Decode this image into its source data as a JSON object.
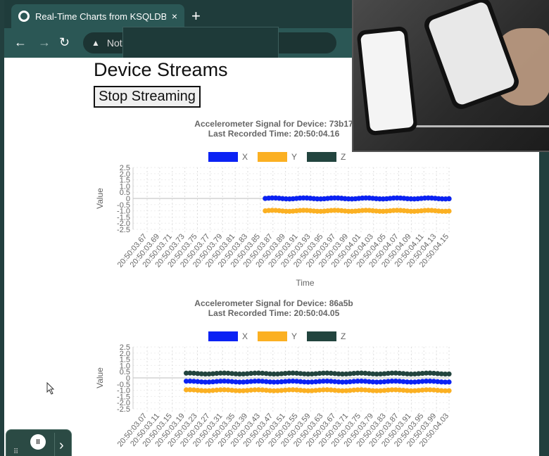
{
  "browser": {
    "tab_title": "Real-Time Charts from KSQLDB",
    "tab_close": "×",
    "new_tab": "+",
    "nav_back": "←",
    "nav_forward": "→",
    "reload": "↻",
    "omnibox_security": "Not"
  },
  "page": {
    "heading": "Device Streams",
    "stop_button": "Stop Streaming"
  },
  "colors": {
    "x": "#0b22f4",
    "y": "#fbb022",
    "z": "#22443e",
    "axis_text": "#666666",
    "grid": "#d8d8d8"
  },
  "charts": [
    {
      "title_line1": "Accelerometer Signal for Device: 73b17",
      "title_line2": "Last Recorded Time:  20:50:04.16",
      "legend": [
        "X",
        "Y",
        "Z"
      ],
      "xlabel": "Time",
      "ylabel": "Value"
    },
    {
      "title_line1": "Accelerometer Signal for Device: 86a5b",
      "title_line2": "Last Recorded Time:  20:50:04.05",
      "legend": [
        "X",
        "Y",
        "Z"
      ],
      "xlabel": "",
      "ylabel": "Value"
    }
  ],
  "chart_data": [
    {
      "type": "line",
      "title": "Accelerometer Signal for Device: 73b17",
      "subtitle": "Last Recorded Time:  20:50:04.16",
      "xlabel": "Time",
      "ylabel": "Value",
      "ylim": [
        -2.5,
        2.5
      ],
      "yticks": [
        "2.5",
        "2.0",
        "1.5",
        "1.0",
        "0.5",
        "0",
        "-0.5",
        "-1.0",
        "-1.5",
        "-2.0",
        "-2.5"
      ],
      "xticks": [
        "20:50:03.67",
        "20:50:03.69",
        "20:50:03.71",
        "20:50:03.73",
        "20:50:03.75",
        "20:50:03.77",
        "20:50:03.79",
        "20:50:03.81",
        "20:50:03.83",
        "20:50:03.85",
        "20:50:03.87",
        "20:50:03.89",
        "20:50:03.91",
        "20:50:03.93",
        "20:50:03.95",
        "20:50:03.97",
        "20:50:03.99",
        "20:50:04.01",
        "20:50:04.03",
        "20:50:04.05",
        "20:50:04.07",
        "20:50:04.09",
        "20:50:04.11",
        "20:50:04.13",
        "20:50:04.15"
      ],
      "x_range": [
        3.67,
        4.16
      ],
      "data_start": 3.875,
      "point_count": 54,
      "series": [
        {
          "name": "X",
          "value": 0.0
        },
        {
          "name": "Y",
          "value": -1.0
        },
        {
          "name": "Z",
          "value": 0.0
        }
      ],
      "legend_position": "top",
      "grid": true
    },
    {
      "type": "line",
      "title": "Accelerometer Signal for Device: 86a5b",
      "subtitle": "Last Recorded Time:  20:50:04.05",
      "xlabel": "",
      "ylabel": "Value",
      "ylim": [
        -2.5,
        2.5
      ],
      "yticks": [
        "2.5",
        "2.0",
        "1.5",
        "1.0",
        "0.5",
        "0",
        "-0.5",
        "-1.0",
        "-1.5",
        "-2.0",
        "-2.5"
      ],
      "xticks": [
        "20:50:03.07",
        "20:50:03.11",
        "20:50:03.15",
        "20:50:03.19",
        "20:50:03.23",
        "20:50:03.27",
        "20:50:03.31",
        "20:50:03.35",
        "20:50:03.39",
        "20:50:03.43",
        "20:50:03.47",
        "20:50:03.51",
        "20:50:03.55",
        "20:50:03.59",
        "20:50:03.63",
        "20:50:03.67",
        "20:50:03.71",
        "20:50:03.75",
        "20:50:03.79",
        "20:50:03.83",
        "20:50:03.87",
        "20:50:03.91",
        "20:50:03.95",
        "20:50:03.99",
        "20:50:04.03"
      ],
      "x_range": [
        3.07,
        4.05
      ],
      "data_start": 3.235,
      "point_count": 70,
      "series": [
        {
          "name": "X",
          "value": -0.3
        },
        {
          "name": "Y",
          "value": -1.0
        },
        {
          "name": "Z",
          "value": 0.35
        }
      ],
      "legend_position": "top",
      "grid": true
    }
  ],
  "mini_player": {
    "pause": "II",
    "expand": "›",
    "grip": "⠿"
  }
}
